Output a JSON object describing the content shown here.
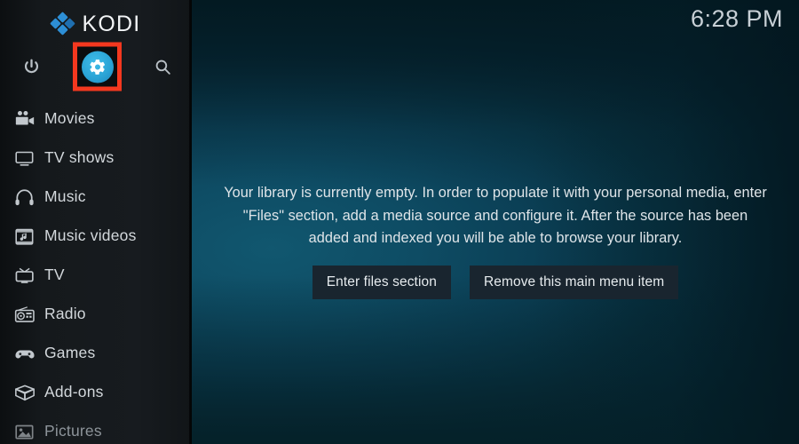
{
  "app": {
    "name": "KODI",
    "logo_icon": "kodi-diamond-logo"
  },
  "sidebar": {
    "quick_actions": [
      {
        "id": "power",
        "icon": "power-icon",
        "label": "Power"
      },
      {
        "id": "settings",
        "icon": "gear-icon",
        "label": "Settings",
        "highlighted": true,
        "highlight_color": "#f4381f",
        "disc_color": "#2ba4d6"
      },
      {
        "id": "search",
        "icon": "search-icon",
        "label": "Search"
      }
    ],
    "items": [
      {
        "label": "Movies",
        "icon": "movie-camera-icon"
      },
      {
        "label": "TV shows",
        "icon": "television-icon"
      },
      {
        "label": "Music",
        "icon": "headphones-icon"
      },
      {
        "label": "Music videos",
        "icon": "film-music-icon"
      },
      {
        "label": "TV",
        "icon": "retro-tv-icon"
      },
      {
        "label": "Radio",
        "icon": "radio-icon"
      },
      {
        "label": "Games",
        "icon": "gamepad-icon"
      },
      {
        "label": "Add-ons",
        "icon": "open-box-icon"
      },
      {
        "label": "Pictures",
        "icon": "picture-icon",
        "dim": true
      }
    ]
  },
  "main": {
    "clock": "6:28 PM",
    "empty_message": "Your library is currently empty. In order to populate it with your personal media, enter \"Files\" section, add a media source and configure it. After the source has been added and indexed you will be able to browse your library.",
    "buttons": [
      {
        "label": "Enter files section"
      },
      {
        "label": "Remove this main menu item"
      }
    ]
  },
  "colors": {
    "accent_blue": "#2ba4d6",
    "highlight_red": "#f4381f",
    "sidebar_bg": "#15191c",
    "button_bg": "#19252f",
    "background_teal": "#0e4c64"
  }
}
